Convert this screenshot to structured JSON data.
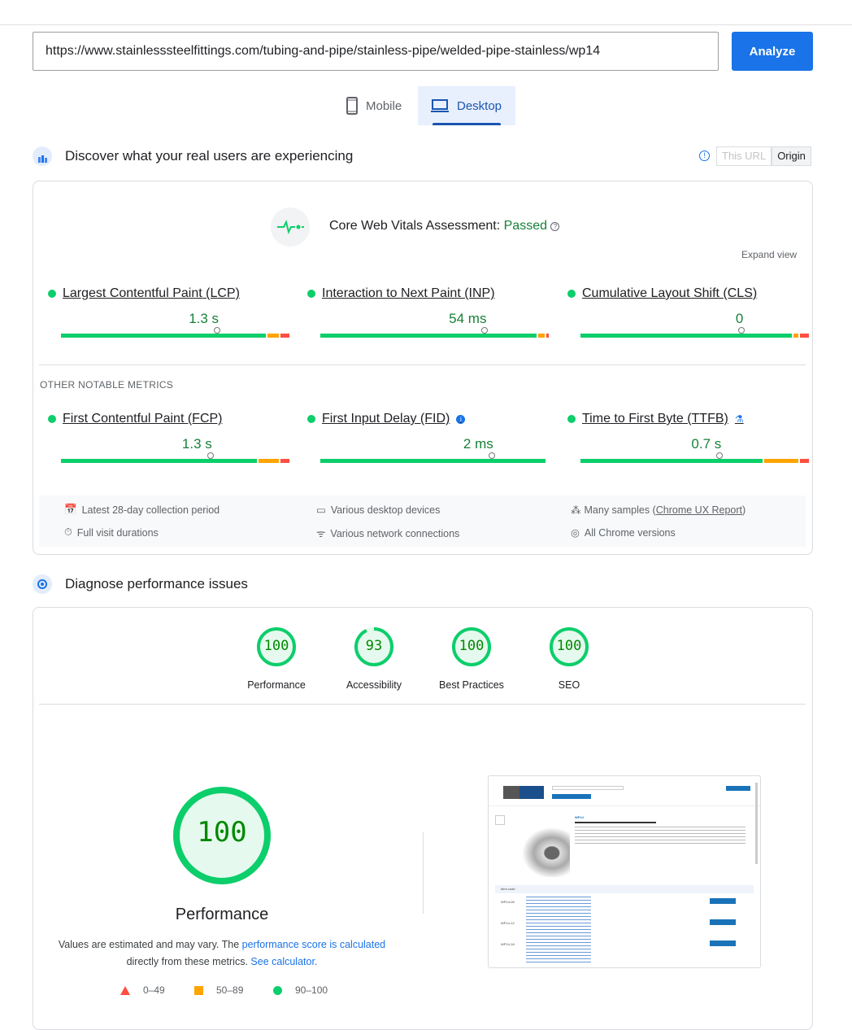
{
  "url_input": {
    "value": "https://www.stainlesssteelfittings.com/tubing-and-pipe/stainless-pipe/welded-pipe-stainless/wp14"
  },
  "analyze_label": "Analyze",
  "tabs": [
    {
      "label": "Mobile",
      "icon": "phone-icon"
    },
    {
      "label": "Desktop",
      "icon": "laptop-icon",
      "active": true
    }
  ],
  "field": {
    "title": "Discover what your real users are experiencing",
    "toggle": [
      "This URL",
      "Origin"
    ],
    "toggle_selected": "Origin",
    "assessment_label": "Core Web Vitals Assessment:",
    "assessment_result": "Passed",
    "expand": "Expand view",
    "core_metrics": [
      {
        "name": "Largest Contentful Paint (LCP)",
        "value": "1.3 s",
        "good_pct": 91,
        "ni_pct": 5,
        "poor_pct": 4
      },
      {
        "name": "Interaction to Next Paint (INP)",
        "value": "54 ms",
        "good_pct": 96,
        "ni_pct": 3,
        "poor_pct": 1
      },
      {
        "name": "Cumulative Layout Shift (CLS)",
        "value": "0",
        "good_pct": 94,
        "ni_pct": 2,
        "poor_pct": 4
      }
    ],
    "other_heading": "OTHER NOTABLE METRICS",
    "other_metrics": [
      {
        "name": "First Contentful Paint (FCP)",
        "value": "1.3 s",
        "good_pct": 87,
        "ni_pct": 9,
        "poor_pct": 4
      },
      {
        "name": "First Input Delay (FID)",
        "value": "2 ms",
        "good_pct": 100,
        "ni_pct": 0,
        "poor_pct": 0
      },
      {
        "name": "Time to First Byte (TTFB)",
        "value": "0.7 s",
        "good_pct": 81,
        "ni_pct": 15,
        "poor_pct": 4
      }
    ],
    "footer": {
      "period": "Latest 28-day collection period",
      "devices": "Various desktop devices",
      "samples_prefix": "Many samples (",
      "samples_link": "Chrome UX Report",
      "samples_suffix": ")",
      "durations": "Full visit durations",
      "network": "Various network connections",
      "chrome": "All Chrome versions"
    }
  },
  "lab": {
    "title": "Diagnose performance issues",
    "scores": [
      {
        "label": "Performance",
        "score": "100"
      },
      {
        "label": "Accessibility",
        "score": "93"
      },
      {
        "label": "Best Practices",
        "score": "100"
      },
      {
        "label": "SEO",
        "score": "100"
      }
    ],
    "big_score": "100",
    "big_label": "Performance",
    "note_1": "Values are estimated and may vary. The ",
    "note_link_1": "performance score is calculated",
    "note_2": "directly from these metrics. ",
    "note_link_2": "See calculator.",
    "legend": [
      "0–49",
      "50–89",
      "90–100"
    ]
  },
  "screenshot": {
    "product_code": "WP14",
    "col_item_code": "Item code",
    "rows": [
      "WP14-06",
      "WP14-12",
      "WP14-18"
    ]
  },
  "colors": {
    "good": "#0cce6b",
    "ni": "#ffa400",
    "poor": "#ff4e42",
    "accent": "#1a73e8"
  }
}
